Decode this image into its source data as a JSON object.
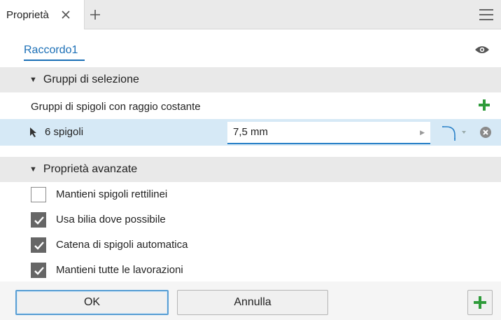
{
  "tabs": [
    {
      "label": "Proprietà"
    }
  ],
  "feature": {
    "name": "Raccordo1"
  },
  "sections": {
    "selection_groups": "Gruppi di selezione",
    "advanced": "Proprietà avanzate"
  },
  "group": {
    "title": "Gruppi di spigoli con raggio costante",
    "selection_label": "6 spigoli",
    "radius_value": "7,5 mm"
  },
  "options": [
    {
      "label": "Mantieni spigoli rettilinei",
      "checked": false
    },
    {
      "label": "Usa bilia dove possibile",
      "checked": true
    },
    {
      "label": "Catena di spigoli automatica",
      "checked": true
    },
    {
      "label": "Mantieni tutte le lavorazioni",
      "checked": true
    }
  ],
  "buttons": {
    "ok": "OK",
    "cancel": "Annulla"
  },
  "colors": {
    "accent": "#1b6fb6",
    "selection_bg": "#d6e9f6",
    "add_green": "#2e9b3a"
  },
  "icons": [
    "close-icon",
    "plus-icon",
    "menu-icon",
    "eye-icon",
    "caret-down-icon",
    "cursor-arrow-icon",
    "fillet-shape-icon",
    "clear-icon",
    "checkmark-icon"
  ]
}
